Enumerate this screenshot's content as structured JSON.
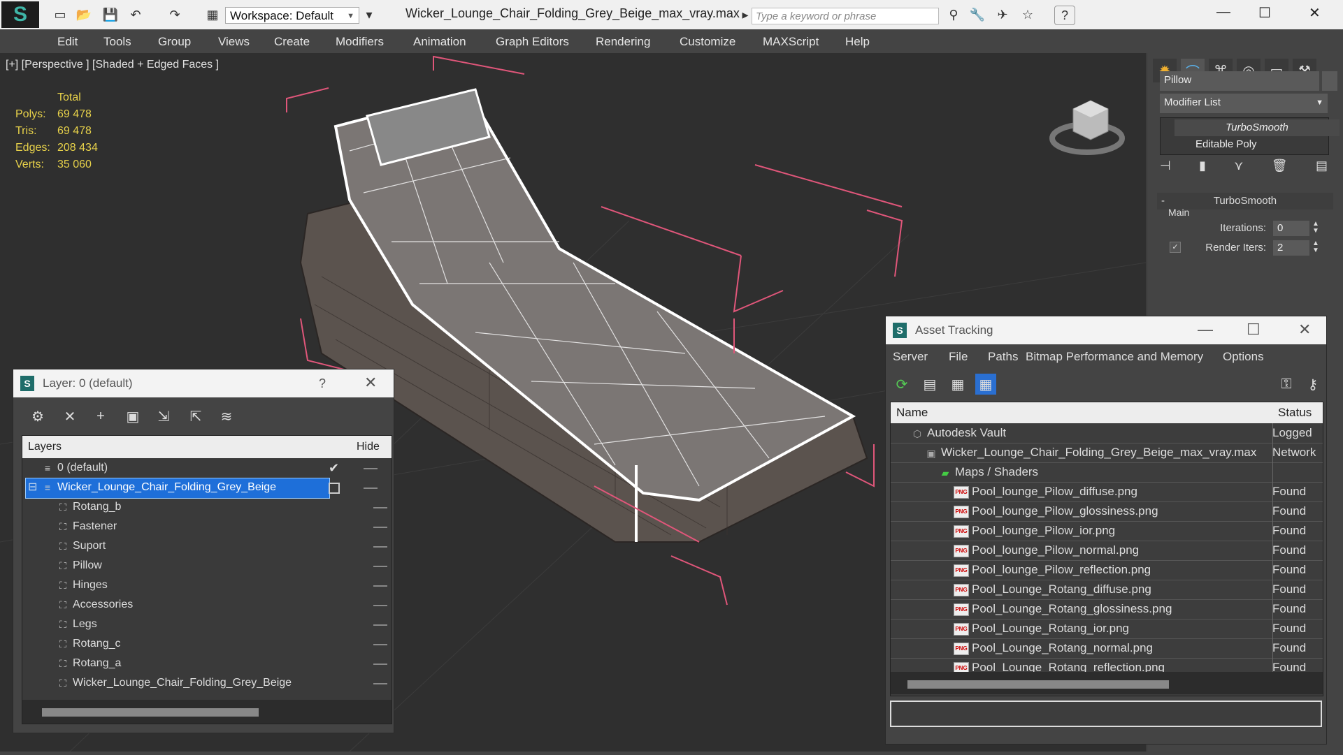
{
  "titlebar": {
    "workspace": "Workspace: Default",
    "file_title": "Wicker_Lounge_Chair_Folding_Grey_Beige_max_vray.max",
    "search_placeholder": "Type a keyword or phrase"
  },
  "menu": [
    "Edit",
    "Tools",
    "Group",
    "Views",
    "Create",
    "Modifiers",
    "Animation",
    "Graph Editors",
    "Rendering",
    "Customize",
    "MAXScript",
    "Help"
  ],
  "viewport": {
    "label": "[+] [Perspective ] [Shaded + Edged Faces ]",
    "stats_header": "Total",
    "stats": [
      {
        "key": "Polys:",
        "value": "69 478"
      },
      {
        "key": "Tris:",
        "value": "69 478"
      },
      {
        "key": "Edges:",
        "value": "208 434"
      },
      {
        "key": "Verts:",
        "value": "35 060"
      }
    ]
  },
  "command_panel": {
    "object_name": "Pillow",
    "modifier_list": "Modifier List",
    "stack": [
      "TurboSmooth",
      "Editable Poly"
    ],
    "rollout_title": "TurboSmooth",
    "group_label": "Main",
    "iterations_label": "Iterations:",
    "iterations_value": "0",
    "render_iters_label": "Render Iters:",
    "render_iters_value": "2"
  },
  "layer_panel": {
    "title": "Layer: 0 (default)",
    "help": "?",
    "col_layers": "Layers",
    "col_hide": "Hide",
    "layers": [
      {
        "name": "0 (default)"
      },
      {
        "name": "Wicker_Lounge_Chair_Folding_Grey_Beige"
      }
    ],
    "objects": [
      "Rotang_b",
      "Fastener",
      "Suport",
      "Pillow",
      "Hinges",
      "Accessories",
      "Legs",
      "Rotang_c",
      "Rotang_a",
      "Wicker_Lounge_Chair_Folding_Grey_Beige"
    ]
  },
  "asset_tracking": {
    "title": "Asset Tracking",
    "menu": [
      "Server",
      "File",
      "Paths",
      "Bitmap Performance and Memory",
      "Options"
    ],
    "col_name": "Name",
    "col_status": "Status",
    "rows": [
      {
        "name": "Autodesk Vault",
        "status": "Logged",
        "indent": 0
      },
      {
        "name": "Wicker_Lounge_Chair_Folding_Grey_Beige_max_vray.max",
        "status": "Network",
        "indent": 1
      },
      {
        "name": "Maps / Shaders",
        "status": "",
        "indent": 2
      },
      {
        "name": "Pool_lounge_Pilow_diffuse.png",
        "status": "Found",
        "indent": 3
      },
      {
        "name": "Pool_lounge_Pilow_glossiness.png",
        "status": "Found",
        "indent": 3
      },
      {
        "name": "Pool_lounge_Pilow_ior.png",
        "status": "Found",
        "indent": 3
      },
      {
        "name": "Pool_lounge_Pilow_normal.png",
        "status": "Found",
        "indent": 3
      },
      {
        "name": "Pool_lounge_Pilow_reflection.png",
        "status": "Found",
        "indent": 3
      },
      {
        "name": "Pool_Lounge_Rotang_diffuse.png",
        "status": "Found",
        "indent": 3
      },
      {
        "name": "Pool_Lounge_Rotang_glossiness.png",
        "status": "Found",
        "indent": 3
      },
      {
        "name": "Pool_Lounge_Rotang_ior.png",
        "status": "Found",
        "indent": 3
      },
      {
        "name": "Pool_Lounge_Rotang_normal.png",
        "status": "Found",
        "indent": 3
      },
      {
        "name": "Pool_Lounge_Rotang_reflection.png",
        "status": "Found",
        "indent": 3
      }
    ]
  },
  "colors": {
    "accent": "#1e6fd9",
    "stats_yellow": "#e8d24a",
    "selection_box": "#e0567a"
  }
}
